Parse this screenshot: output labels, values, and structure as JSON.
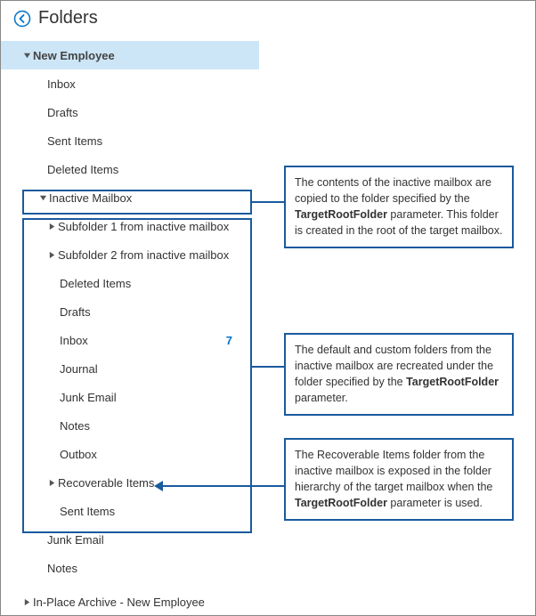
{
  "header": {
    "title": "Folders"
  },
  "tree": {
    "root": "New Employee",
    "inbox": "Inbox",
    "drafts": "Drafts",
    "sentItems": "Sent Items",
    "deletedItems": "Deleted Items",
    "inactiveMailbox": "Inactive Mailbox",
    "sub1": "Subfolder 1 from inactive mailbox",
    "sub2": "Subfolder 2 from inactive mailbox",
    "imDeletedItems": "Deleted Items",
    "imDrafts": "Drafts",
    "imInbox": "Inbox",
    "imInboxCount": "7",
    "imJournal": "Journal",
    "imJunk": "Junk Email",
    "imNotes": "Notes",
    "imOutbox": "Outbox",
    "imRecoverable": "Recoverable Items",
    "imSentItems": "Sent Items",
    "junkEmail": "Junk Email",
    "notes": "Notes",
    "archive": "In-Place Archive - New Employee"
  },
  "callouts": {
    "c1a": "The contents of the inactive mailbox are copied to the folder specified by the ",
    "c1b": "TargetRootFolder",
    "c1c": " parameter. This folder is created in the root of the target mailbox.",
    "c2a": "The default and custom folders from the inactive mailbox are recreated under the folder specified by the ",
    "c2b": "TargetRootFolder",
    "c2c": " parameter.",
    "c3a": "The Recoverable Items folder from the inactive mailbox is exposed in the folder hierarchy of the target mailbox when the ",
    "c3b": "TargetRootFolder",
    "c3c": " parameter is used."
  }
}
